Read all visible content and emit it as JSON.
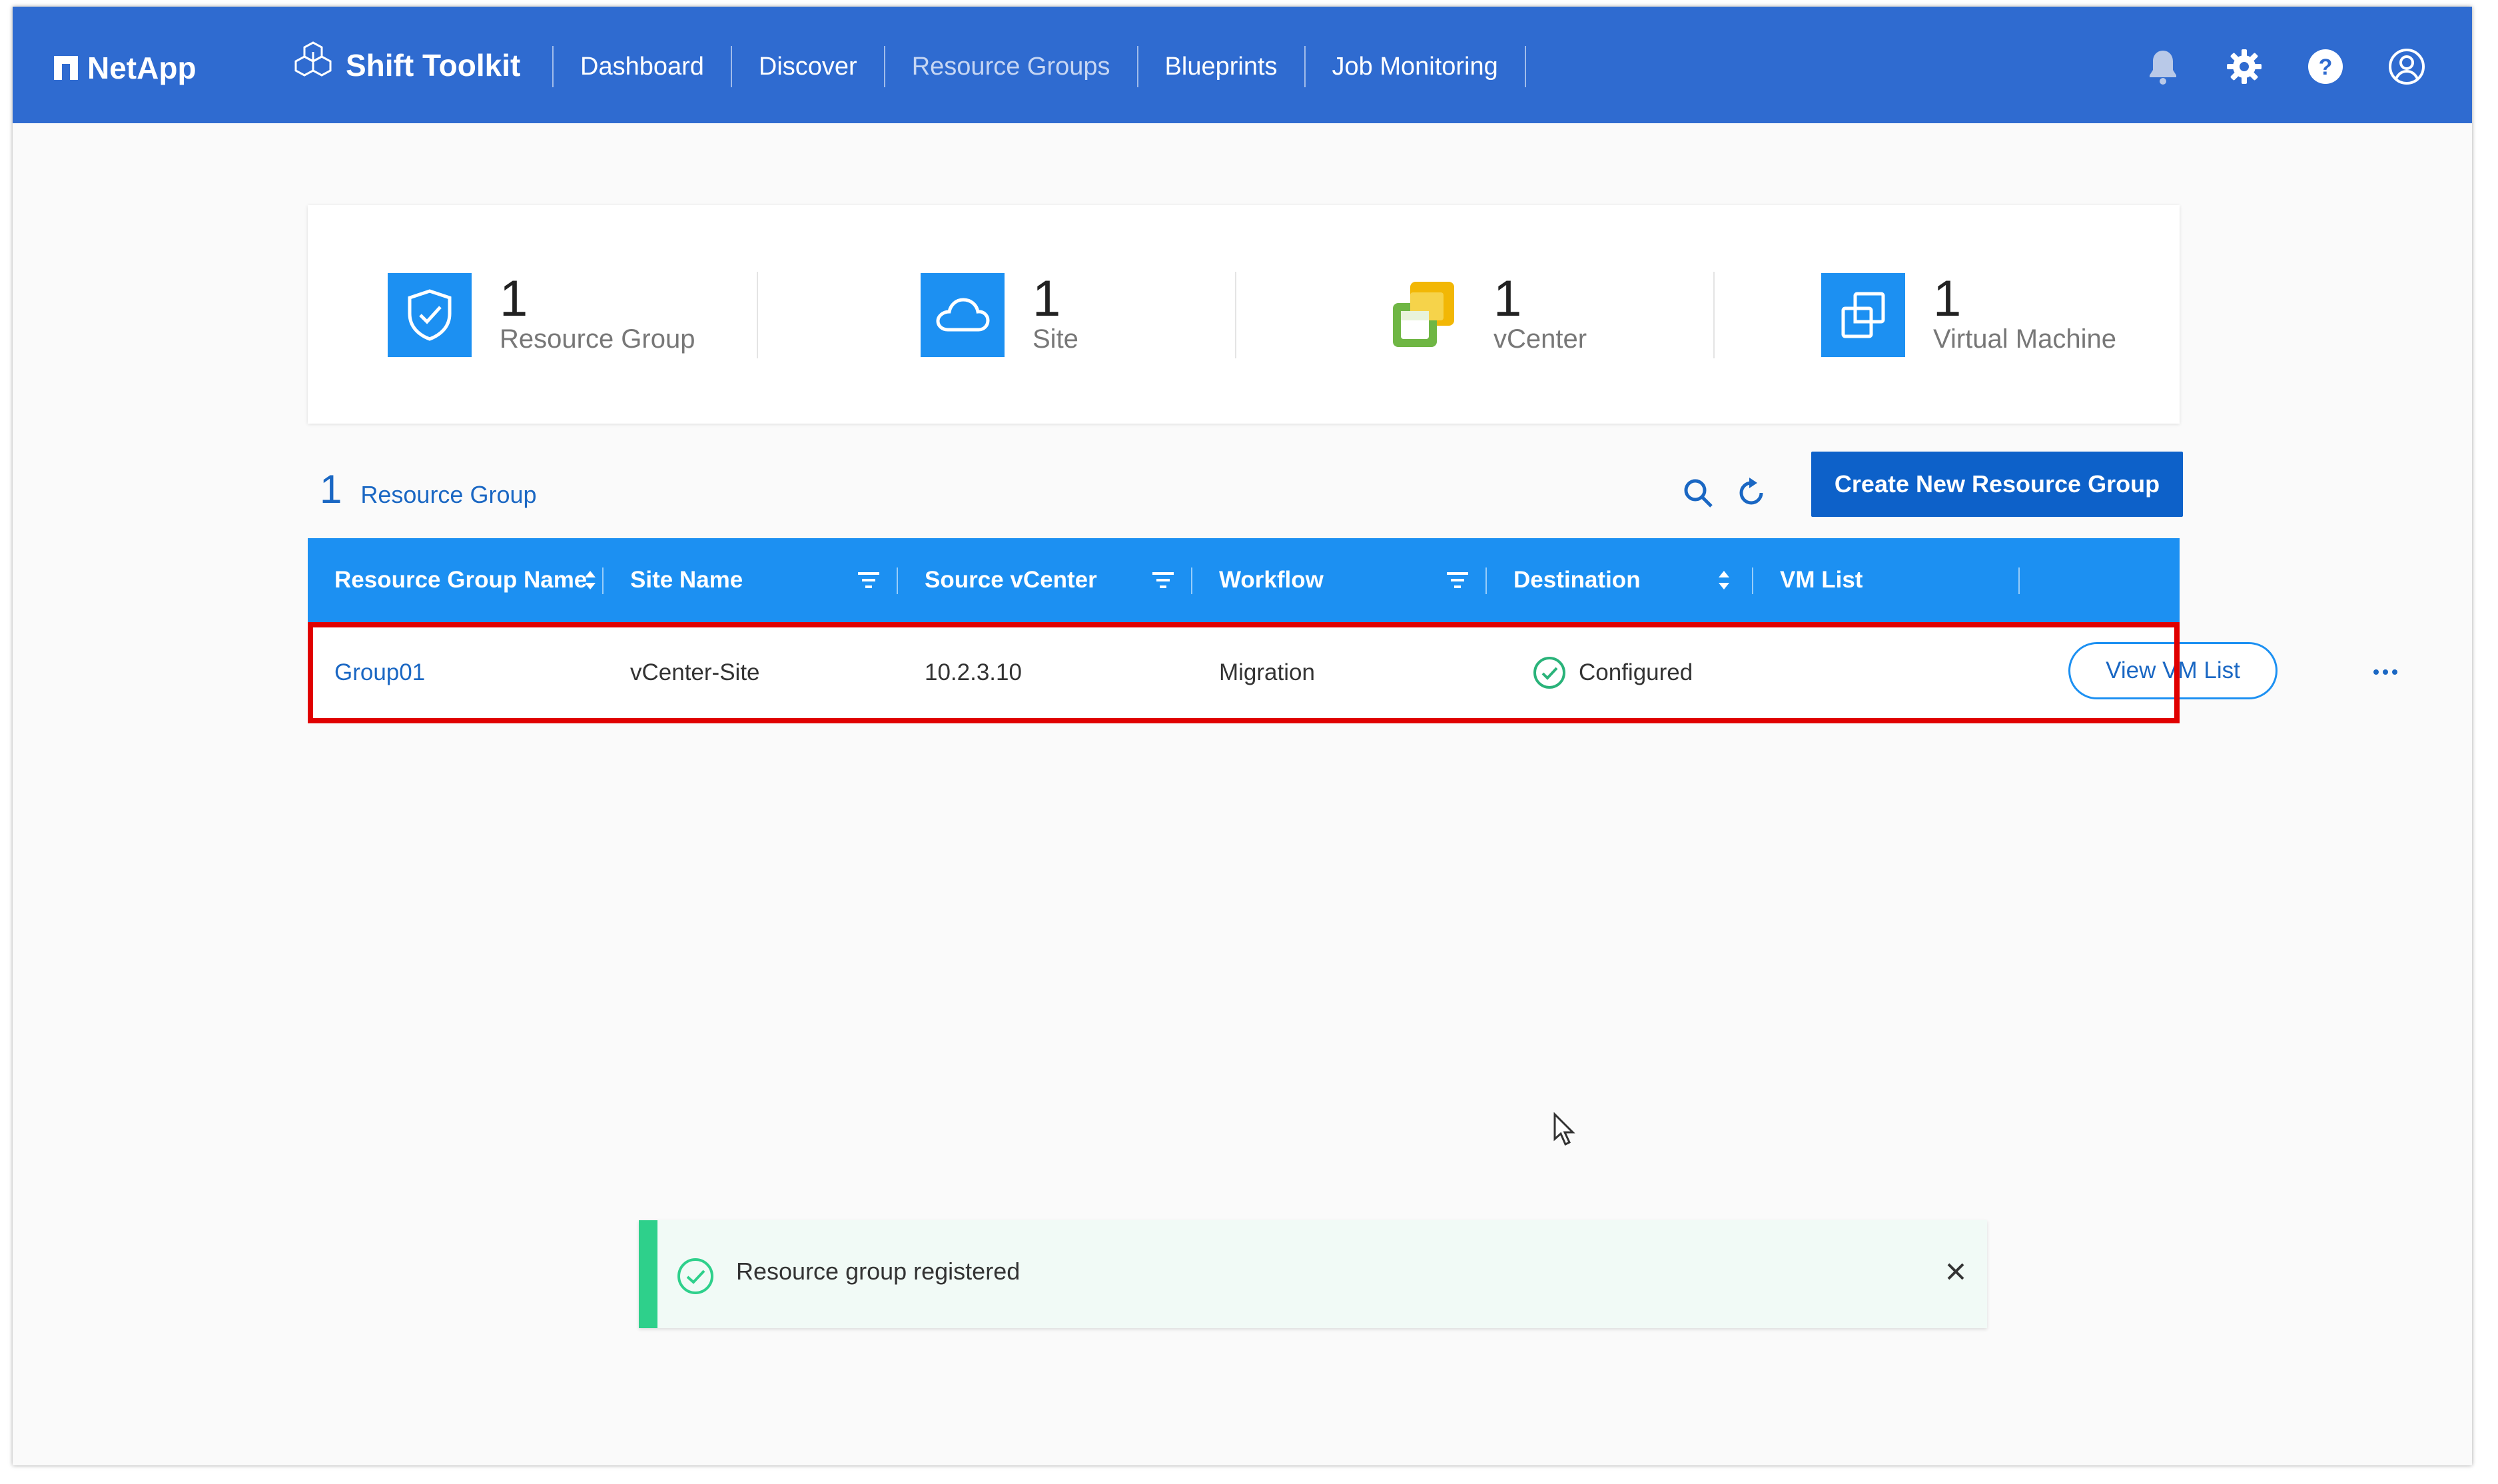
{
  "brand": {
    "name": "NetApp"
  },
  "app": {
    "title": "Shift Toolkit"
  },
  "nav": {
    "items": [
      {
        "label": "Dashboard"
      },
      {
        "label": "Discover"
      },
      {
        "label": "Resource Groups",
        "active": true
      },
      {
        "label": "Blueprints"
      },
      {
        "label": "Job Monitoring"
      }
    ]
  },
  "header_icons": [
    "bell-icon",
    "gear-icon",
    "help-icon",
    "user-icon"
  ],
  "summary": {
    "stats": [
      {
        "count": "1",
        "label": "Resource Group",
        "icon": "shield-check-icon"
      },
      {
        "count": "1",
        "label": "Site",
        "icon": "cloud-icon"
      },
      {
        "count": "1",
        "label": "vCenter",
        "icon": "vcenter-icon"
      },
      {
        "count": "1",
        "label": "Virtual Machine",
        "icon": "virtual-machine-icon"
      }
    ]
  },
  "list": {
    "count": "1",
    "label": "Resource Group",
    "create_button": "Create New Resource Group"
  },
  "table": {
    "columns": [
      {
        "label": "Resource Group Name",
        "control": "sort"
      },
      {
        "label": "Site Name",
        "control": "filter"
      },
      {
        "label": "Source vCenter",
        "control": "filter"
      },
      {
        "label": "Workflow",
        "control": "filter"
      },
      {
        "label": "Destination",
        "control": "sort"
      },
      {
        "label": "VM List",
        "control": "none"
      }
    ],
    "rows": [
      {
        "name": "Group01",
        "site": "vCenter-Site",
        "vcenter": "10.2.3.10",
        "workflow": "Migration",
        "destination": "Configured",
        "vm_list_button": "View VM List"
      }
    ]
  },
  "toast": {
    "message": "Resource group registered"
  },
  "colors": {
    "topbar": "#2f6bd0",
    "table_header": "#1c90f2",
    "primary_button": "#0d61c9",
    "success": "#2ed08b",
    "highlight": "#e00000"
  }
}
